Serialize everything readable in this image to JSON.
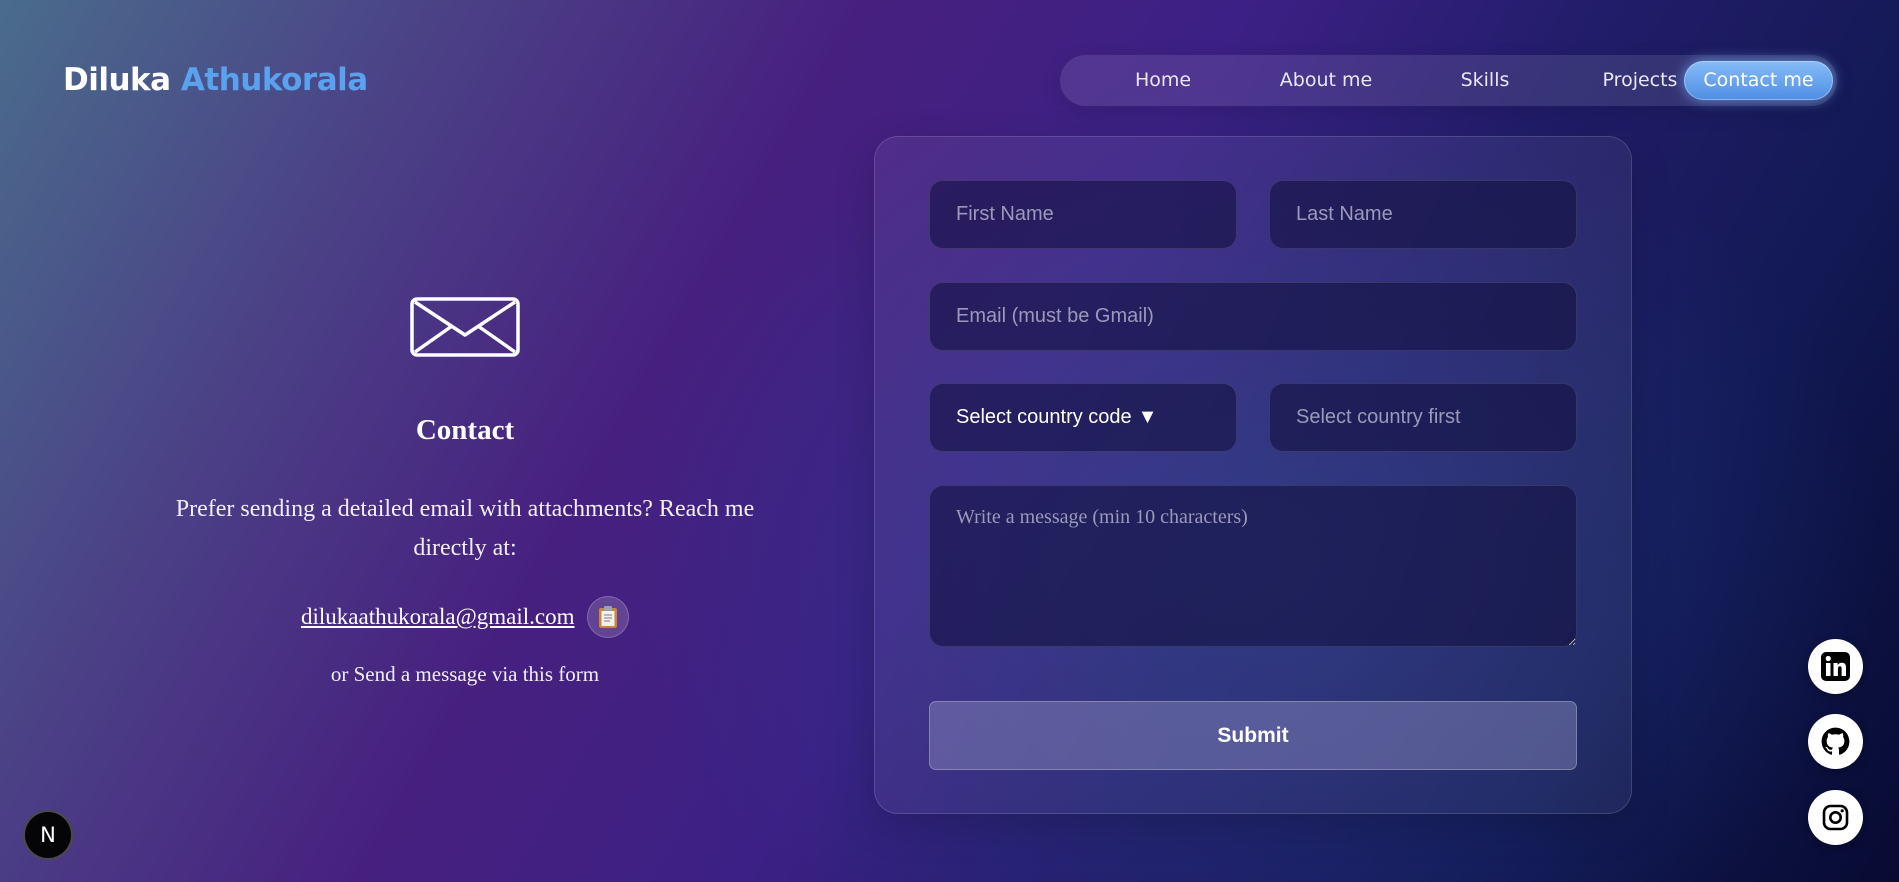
{
  "brand": {
    "first": "Diluka",
    "last": "Athukorala"
  },
  "nav": {
    "items": [
      {
        "label": "Home"
      },
      {
        "label": "About me"
      },
      {
        "label": "Skills"
      },
      {
        "label": "Projects"
      },
      {
        "label": "Contact me",
        "active": true
      }
    ]
  },
  "contact": {
    "icon": "envelope-icon",
    "title": "Contact",
    "description": "Prefer sending a detailed email with attachments? Reach me directly at:",
    "email": "dilukaathukorala@gmail.com",
    "copy_icon": "clipboard-icon",
    "form_note": "or Send a message via this form"
  },
  "form": {
    "first_name_placeholder": "First Name",
    "last_name_placeholder": "Last Name",
    "email_placeholder": "Email (must be Gmail)",
    "country_code_label": "Select country code",
    "country_code_caret": "▼",
    "phone_placeholder": "Select country first",
    "message_placeholder": "Write a message (min 10 characters)",
    "submit_label": "Submit"
  },
  "social": [
    {
      "icon": "linkedin-icon"
    },
    {
      "icon": "github-icon"
    },
    {
      "icon": "instagram-icon"
    }
  ],
  "badge": {
    "label": "N"
  },
  "colors": {
    "accent": "#5aa2ef",
    "active_nav": "#6aa6f0",
    "background_dark": "#070b32",
    "background_purple": "#47207f"
  }
}
